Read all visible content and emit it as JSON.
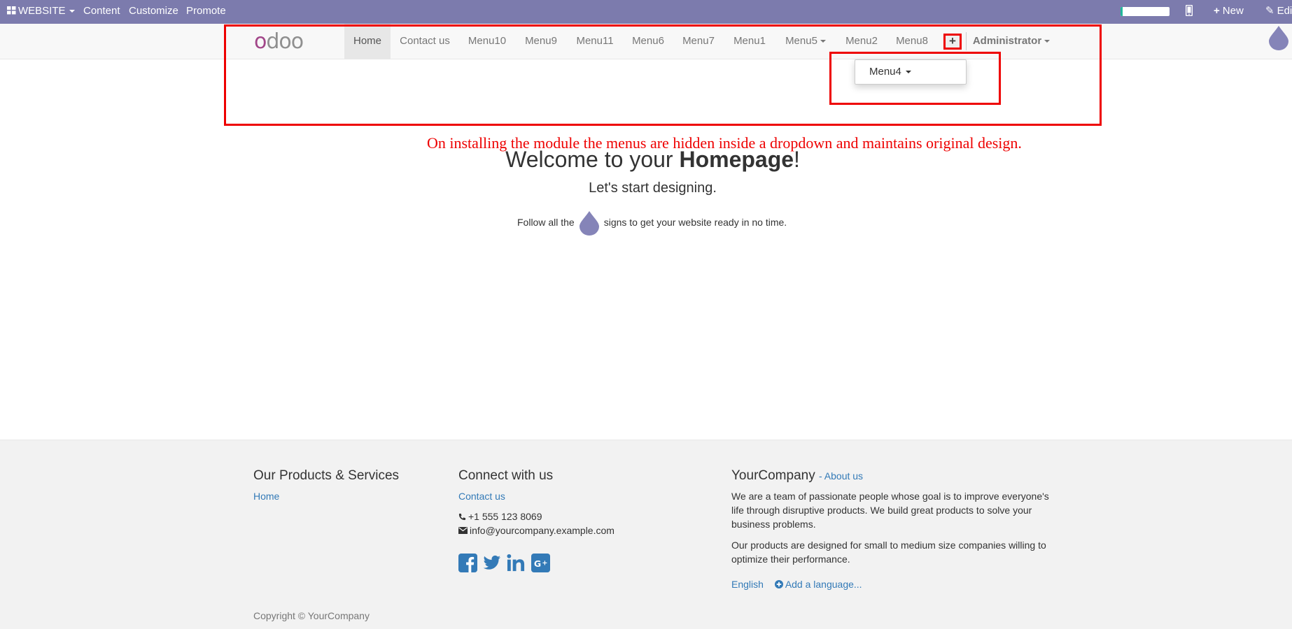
{
  "admin_bar": {
    "website_label": "WEBSITE",
    "content_label": "Content",
    "customize_label": "Customize",
    "promote_label": "Promote",
    "progress_fraction": 0.04,
    "new_label": "New",
    "edit_label": "Edi"
  },
  "header": {
    "logo_text": "odoo",
    "nav": [
      {
        "label": "Home"
      },
      {
        "label": "Contact us"
      },
      {
        "label": "Menu10"
      },
      {
        "label": "Menu9"
      },
      {
        "label": "Menu11"
      },
      {
        "label": "Menu6"
      },
      {
        "label": "Menu7"
      },
      {
        "label": "Menu1"
      },
      {
        "label": "Menu5"
      },
      {
        "label": "Menu2"
      },
      {
        "label": "Menu8"
      }
    ],
    "more_glyph": "+",
    "user_label": "Administrator"
  },
  "dropdown": {
    "item_label": "Menu4"
  },
  "annotation": "On installing the module the menus are hidden inside a dropdown and maintains original design.",
  "hero": {
    "title_prefix": "Welcome to your ",
    "title_bold": "Homepage",
    "title_suffix": "!",
    "subtitle": "Let's start designing.",
    "follow_before": "Follow all the",
    "follow_after": "signs to get your website ready in no time."
  },
  "footer": {
    "col1_title": "Our Products & Services",
    "col1_link": "Home",
    "col2_title": "Connect with us",
    "col2_link": "Contact us",
    "phone": "+1 555 123 8069",
    "email": "info@yourcompany.example.com",
    "social_icons": [
      "facebook-icon",
      "twitter-icon",
      "linkedin-icon",
      "google-plus-icon"
    ],
    "col3_title": "YourCompany",
    "col3_about": "- About us",
    "about_p1": "We are a team of passionate people whose goal is to improve everyone's life through disruptive products. We build great products to solve your business problems.",
    "about_p2": "Our products are designed for small to medium size companies willing to optimize their performance.",
    "language": "English",
    "add_language": "Add a language...",
    "copyright": "Copyright © YourCompany"
  },
  "colors": {
    "admin_bar": "#7c7bad",
    "annotation_red": "#ee0000",
    "link_blue": "#337ab7",
    "logo_purple": "#a24689",
    "logo_grey": "#8f8f8f",
    "droplet": "#8584b8"
  }
}
